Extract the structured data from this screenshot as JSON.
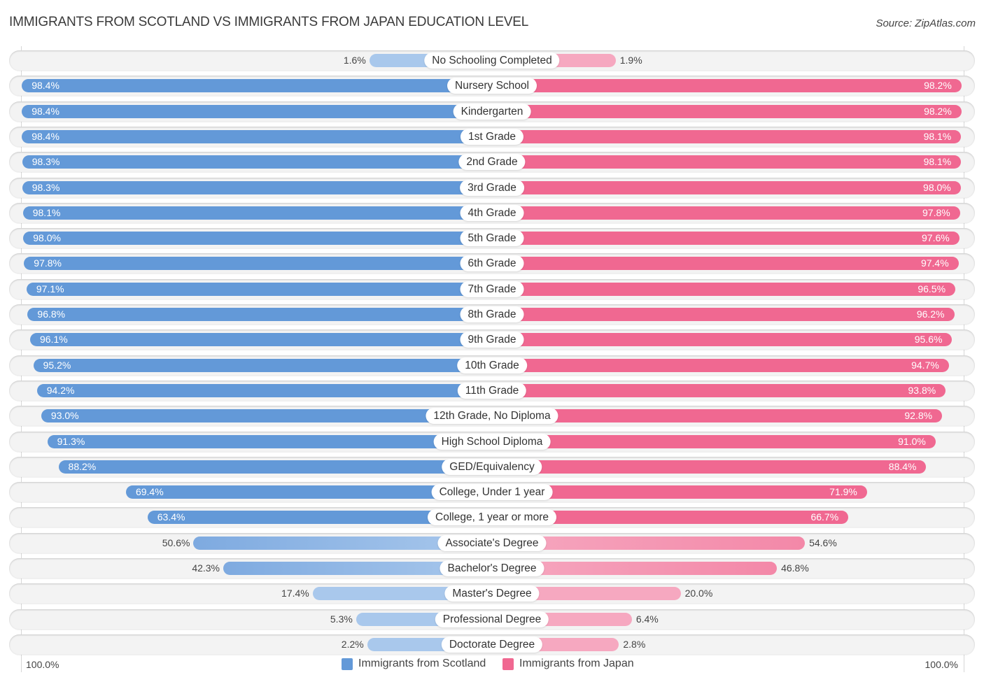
{
  "header": {
    "title": "IMMIGRANTS FROM SCOTLAND VS IMMIGRANTS FROM JAPAN EDUCATION LEVEL",
    "source": "Source: ZipAtlas.com"
  },
  "colors": {
    "scotland": "#6399d8",
    "scotland_light": "#a9c8ec",
    "japan": "#f06891",
    "japan_light": "#f6a8c0"
  },
  "axis": {
    "left_label": "100.0%",
    "right_label": "100.0%"
  },
  "legend": {
    "items": [
      {
        "label": "Immigrants from Scotland",
        "color": "#6399d8"
      },
      {
        "label": "Immigrants from Japan",
        "color": "#f06891"
      }
    ]
  },
  "chart_data": {
    "type": "bar",
    "orientation": "horizontal-diverging",
    "title": "IMMIGRANTS FROM SCOTLAND VS IMMIGRANTS FROM JAPAN EDUCATION LEVEL",
    "xlabel": "",
    "ylabel": "",
    "xlim": [
      0,
      100
    ],
    "unit": "%",
    "legend_position": "bottom-center",
    "grid": false,
    "categories": [
      "No Schooling Completed",
      "Nursery School",
      "Kindergarten",
      "1st Grade",
      "2nd Grade",
      "3rd Grade",
      "4th Grade",
      "5th Grade",
      "6th Grade",
      "7th Grade",
      "8th Grade",
      "9th Grade",
      "10th Grade",
      "11th Grade",
      "12th Grade, No Diploma",
      "High School Diploma",
      "GED/Equivalency",
      "College, Under 1 year",
      "College, 1 year or more",
      "Associate's Degree",
      "Bachelor's Degree",
      "Master's Degree",
      "Professional Degree",
      "Doctorate Degree"
    ],
    "series": [
      {
        "name": "Immigrants from Scotland",
        "side": "left",
        "values": [
          1.6,
          98.4,
          98.4,
          98.4,
          98.3,
          98.3,
          98.1,
          98.0,
          97.8,
          97.1,
          96.8,
          96.1,
          95.2,
          94.2,
          93.0,
          91.3,
          88.2,
          69.4,
          63.4,
          50.6,
          42.3,
          17.4,
          5.3,
          2.2
        ],
        "labels": [
          "1.6%",
          "98.4%",
          "98.4%",
          "98.4%",
          "98.3%",
          "98.3%",
          "98.1%",
          "98.0%",
          "97.8%",
          "97.1%",
          "96.8%",
          "96.1%",
          "95.2%",
          "94.2%",
          "93.0%",
          "91.3%",
          "88.2%",
          "69.4%",
          "63.4%",
          "50.6%",
          "42.3%",
          "17.4%",
          "5.3%",
          "2.2%"
        ]
      },
      {
        "name": "Immigrants from Japan",
        "side": "right",
        "values": [
          1.9,
          98.2,
          98.2,
          98.1,
          98.1,
          98.0,
          97.8,
          97.6,
          97.4,
          96.5,
          96.2,
          95.6,
          94.7,
          93.8,
          92.8,
          91.0,
          88.4,
          71.9,
          66.7,
          54.6,
          46.8,
          20.0,
          6.4,
          2.8
        ],
        "labels": [
          "1.9%",
          "98.2%",
          "98.2%",
          "98.1%",
          "98.1%",
          "98.0%",
          "97.8%",
          "97.6%",
          "97.4%",
          "96.5%",
          "96.2%",
          "95.6%",
          "94.7%",
          "93.8%",
          "92.8%",
          "91.0%",
          "88.4%",
          "71.9%",
          "66.7%",
          "54.6%",
          "46.8%",
          "20.0%",
          "6.4%",
          "2.8%"
        ]
      }
    ]
  }
}
